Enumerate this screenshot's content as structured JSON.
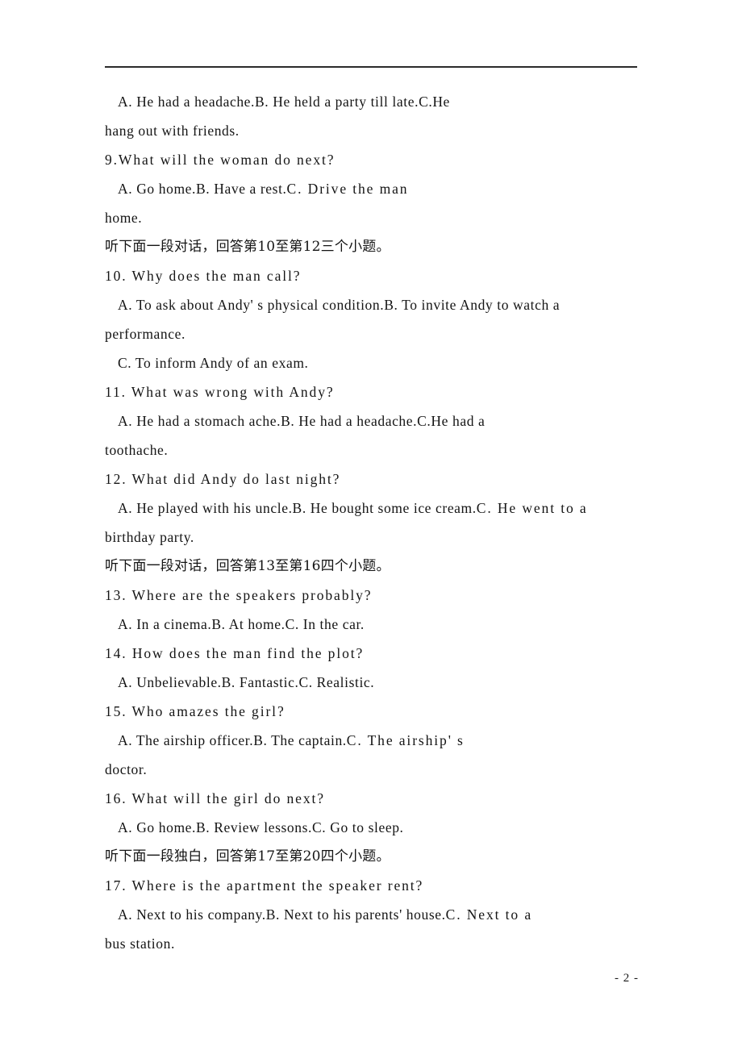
{
  "page": {
    "number_label": "- 2 -",
    "has_header_rule": true
  },
  "content": {
    "q8_options": {
      "a": "A. He had a headache.",
      "b": "B. He held a party till late.",
      "c_label": "C.",
      "c_text": "He",
      "c_continuation": "hang out with friends."
    },
    "q9": {
      "question": "9.What will the woman do next?",
      "a": "A. Go home.",
      "b": "B. Have a rest.",
      "c_label": "C. Drive the man",
      "c_continuation": "home."
    },
    "instruction_10_12": "听下面一段对话，回答第10至第12三个小题。",
    "q10": {
      "question": "10. Why does the man call?",
      "a": "A. To ask about Andy' s physical condition.",
      "b": "B.  To  invite  Andy  to  watch  a",
      "b_continuation": "performance.",
      "c": "C. To inform Andy of an exam."
    },
    "q11": {
      "question": "11. What was wrong with Andy?",
      "a": "A. He had a stomach ache.",
      "b": "B. He had a headache.",
      "c_label": "C.",
      "c_text": "He    had    a",
      "c_continuation": "toothache."
    },
    "q12": {
      "question": "12. What did Andy do last night?",
      "a": "A. He played with his uncle.",
      "b": "B. He bought some ice cream.",
      "c": "C. He went to a",
      "c_continuation": "birthday party."
    },
    "instruction_13_16": "听下面一段对话，回答第13至第16四个小题。",
    "q13": {
      "question": "13. Where are the speakers probably?",
      "a": "A. In a cinema.",
      "b": "B. At home.",
      "c": "C. In the car."
    },
    "q14": {
      "question": "14. How does the man find the plot?",
      "a": "A. Unbelievable.",
      "b": "B. Fantastic.",
      "c": "C. Realistic."
    },
    "q15": {
      "question": "15. Who amazes the girl?",
      "a": "A. The airship officer.",
      "b": "B. The captain.",
      "c": "C. The airship' s",
      "c_continuation": "doctor."
    },
    "q16": {
      "question": "16. What will the girl do next?",
      "a": "A. Go home.",
      "b": "B. Review lessons.",
      "c": "C. Go to sleep."
    },
    "instruction_17_20": "听下面一段独白，回答第17至第20四个小题。",
    "q17": {
      "question": "17. Where is the apartment the speaker rent?",
      "a": "A. Next to his company.",
      "b": "B. Next to his parents'  house.",
      "c": "C. Next to a",
      "c_continuation": "bus station."
    }
  }
}
